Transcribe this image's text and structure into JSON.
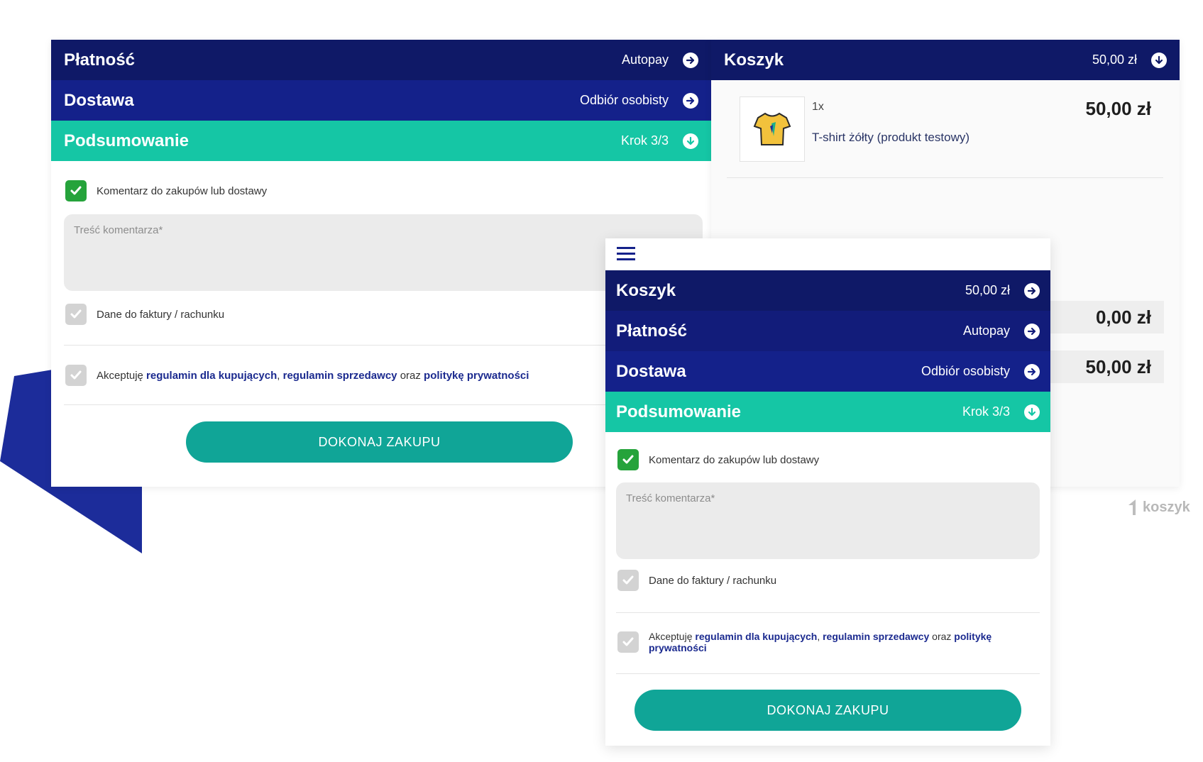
{
  "left_panel": {
    "bars": [
      {
        "title": "Płatność",
        "value": "Autopay",
        "icon": "arrow-right-icon"
      },
      {
        "title": "Dostawa",
        "value": "Odbiór osobisty",
        "icon": "arrow-right-icon"
      },
      {
        "title": "Podsumowanie",
        "value": "Krok 3/3",
        "icon": "arrow-down-icon"
      }
    ],
    "comment_checkbox_label": "Komentarz do zakupów lub dostawy",
    "comment_placeholder": "Treść komentarza*",
    "invoice_checkbox_label": "Dane do faktury / rachunku",
    "terms": {
      "prefix": "Akceptuję",
      "link1": "regulamin dla kupujących",
      "sep": ",",
      "link2": "regulamin sprzedawcy",
      "middle": "oraz",
      "link3": "politykę prywatności"
    },
    "purchase_button": "DOKONAJ ZAKUPU"
  },
  "cart_panel": {
    "title": "Koszyk",
    "total": "50,00 zł",
    "item": {
      "qty": "1x",
      "name": "T-shirt żółty (produkt testowy)",
      "price": "50,00 zł"
    },
    "summary_values": [
      "0,00 zł",
      "50,00 zł"
    ],
    "brand": "koszyk"
  },
  "mobile_panel": {
    "bars": [
      {
        "title": "Koszyk",
        "value": "50,00 zł",
        "icon": "arrow-right-icon"
      },
      {
        "title": "Płatność",
        "value": "Autopay",
        "icon": "arrow-right-icon"
      },
      {
        "title": "Dostawa",
        "value": "Odbiór osobisty",
        "icon": "arrow-right-icon"
      },
      {
        "title": "Podsumowanie",
        "value": "Krok 3/3",
        "icon": "arrow-down-icon"
      }
    ],
    "comment_checkbox_label": "Komentarz do zakupów lub dostawy",
    "comment_placeholder": "Treść komentarza*",
    "invoice_checkbox_label": "Dane do faktury / rachunku",
    "terms": {
      "prefix": "Akceptuję",
      "link1": "regulamin dla kupujących",
      "sep": ",",
      "link2": "regulamin sprzedawcy",
      "middle": "oraz",
      "link3": "politykę prywatności"
    },
    "purchase_button": "DOKONAJ ZAKUPU"
  },
  "colors": {
    "navy_dark": "#0f1967",
    "navy": "#14218a",
    "teal": "#15c6a5",
    "button": "#10a597",
    "check": "#25a33b",
    "link": "#1b2a8f"
  }
}
